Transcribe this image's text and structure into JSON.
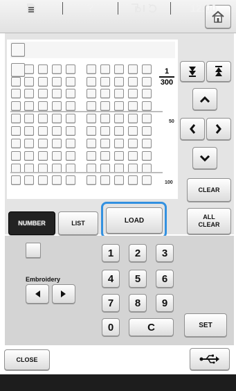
{
  "pattern": {
    "page_current": "1",
    "page_total": "300",
    "row_marker_50": "50",
    "row_marker_100": "100"
  },
  "buttons": {
    "clear": "CLEAR",
    "all_clear_line1": "ALL",
    "all_clear_line2": "CLEAR",
    "number": "NUMBER",
    "list": "LIST",
    "load": "LOAD",
    "set": "SET",
    "close": "CLOSE"
  },
  "category": {
    "label": "Embroidery"
  },
  "keypad": {
    "row1": [
      "1",
      "2",
      "3"
    ],
    "row2": [
      "4",
      "5",
      "6"
    ],
    "row3": [
      "7",
      "8",
      "9"
    ],
    "zero": "0",
    "clear": "C"
  },
  "status_bar": {
    "help": "?",
    "time": "12:00"
  },
  "colors": {
    "load_highlight": "#3391e0",
    "number_tab_active": "#222222"
  },
  "icons": [
    "home-icon",
    "arrow-down-bar-icon",
    "arrow-up-bar-icon",
    "chevron-up-icon",
    "chevron-down-icon",
    "chevron-left-icon",
    "chevron-right-icon",
    "triangle-left-icon",
    "triangle-right-icon",
    "usb-icon",
    "document-icon",
    "help-icon",
    "machine-status-icon",
    "time-icon"
  ]
}
